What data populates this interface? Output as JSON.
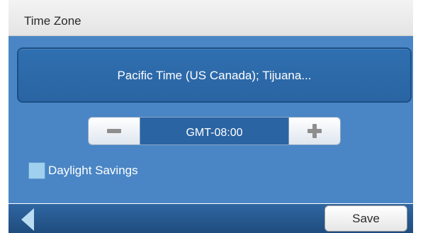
{
  "header": {
    "title": "Time Zone"
  },
  "timezone": {
    "name": "Pacific Time (US  Canada); Tijuana..."
  },
  "offset": {
    "value": "GMT-08:00"
  },
  "daylight": {
    "label": "Daylight Savings",
    "checked": false
  },
  "footer": {
    "save_label": "Save"
  },
  "colors": {
    "accent": "#4a86c5",
    "panel": "#2a64a3",
    "footer": "#1f4c7e"
  },
  "icons": {
    "minus": "minus-icon",
    "plus": "plus-icon",
    "back": "back-arrow-icon"
  }
}
